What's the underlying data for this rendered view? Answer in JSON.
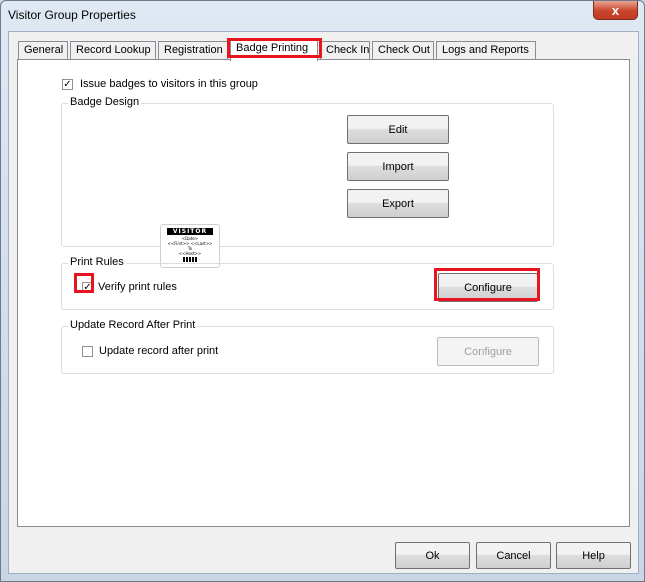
{
  "window": {
    "title": "Visitor Group Properties",
    "close_glyph": "x"
  },
  "tabs": [
    {
      "label": "General"
    },
    {
      "label": "Record Lookup"
    },
    {
      "label": "Registration"
    },
    {
      "label": "Badge Printing"
    },
    {
      "label": "Check In"
    },
    {
      "label": "Check Out"
    },
    {
      "label": "Logs and Reports"
    }
  ],
  "active_tab": "Badge Printing",
  "issue_badges": {
    "label": "Issue badges to visitors in this group",
    "checked": true
  },
  "badge_design": {
    "title": "Badge Design",
    "preview": {
      "header": "VISITOR",
      "line1": "<Date>",
      "line2": "<<First>> <<Last>>",
      "line3": "To",
      "line4": "<<Host>>"
    },
    "buttons": {
      "edit": "Edit",
      "import": "Import",
      "export": "Export"
    }
  },
  "print_rules": {
    "title": "Print Rules",
    "verify_label": "Verify print rules",
    "verify_checked": true,
    "configure_label": "Configure"
  },
  "update_record": {
    "title": "Update Record After Print",
    "checkbox_label": "Update record after print",
    "checked": false,
    "configure_label": "Configure"
  },
  "footer": {
    "ok": "Ok",
    "cancel": "Cancel",
    "help": "Help"
  },
  "colors": {
    "highlight": "#e8141f",
    "close_button": "#c9452c"
  }
}
